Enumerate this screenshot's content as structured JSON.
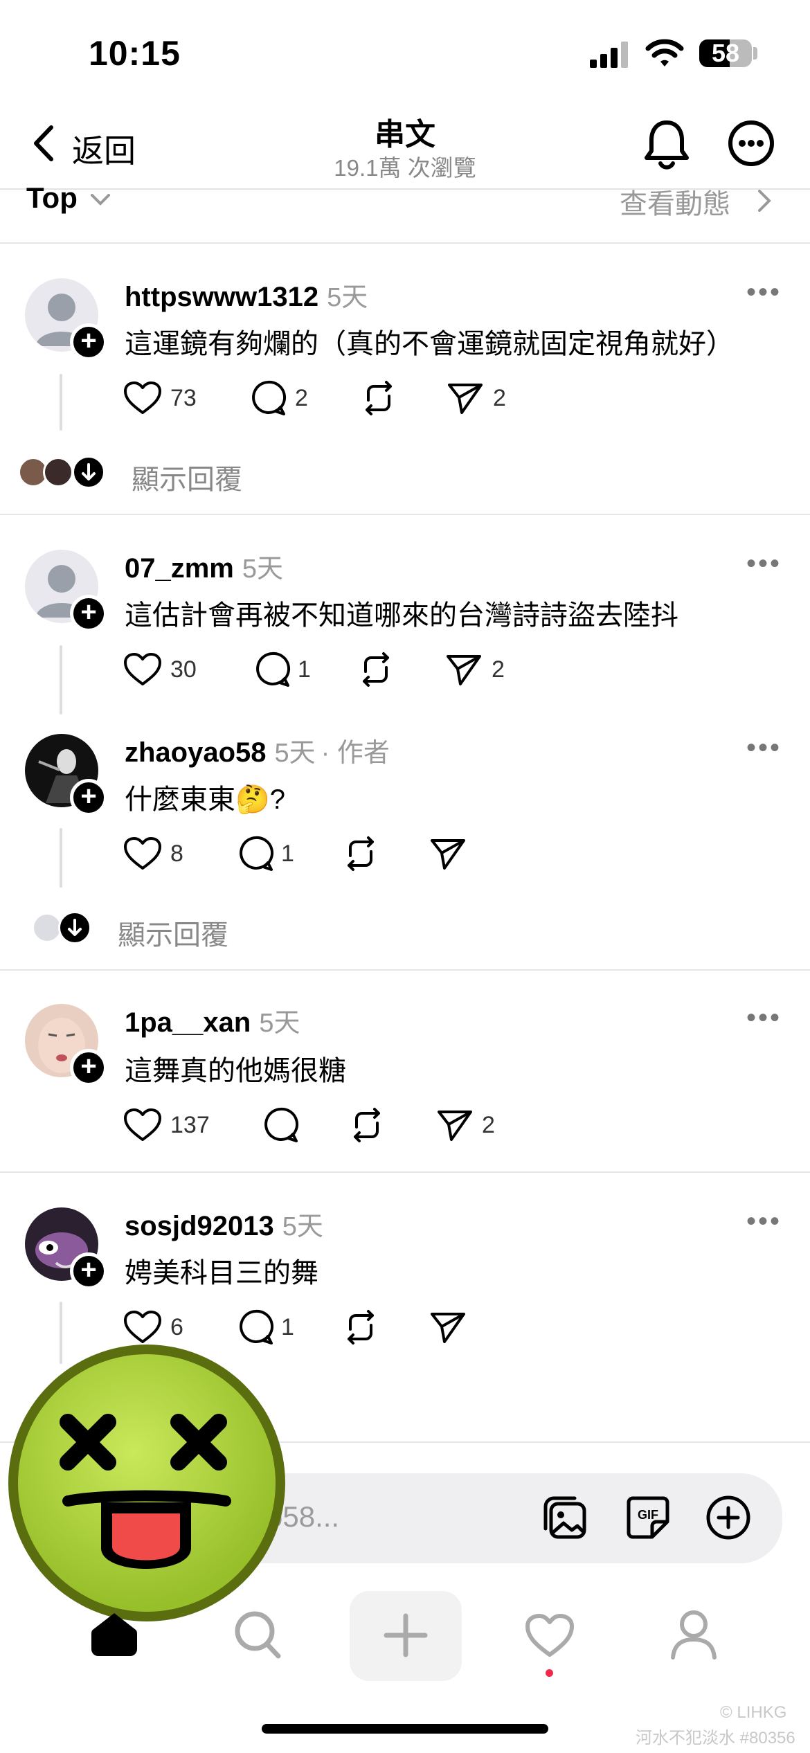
{
  "status_bar": {
    "time": "10:15",
    "battery": "58",
    "battery_level": 0.58
  },
  "header": {
    "back_label": "返回",
    "title": "串文",
    "subtitle": "19.1萬 次瀏覽"
  },
  "filter": {
    "sort_label": "Top",
    "activity_label": "查看動態"
  },
  "comments": [
    {
      "username": "httpswww1312",
      "time": "5天",
      "text": "這運鏡有夠爛的（真的不會運鏡就固定視角就好）",
      "likes": "73",
      "replies": "2",
      "shares": "2"
    },
    {
      "username": "07_zmm",
      "time": "5天",
      "text": "這估計會再被不知道哪來的台灣詩詩盜去陸抖",
      "likes": "30",
      "replies": "1",
      "shares": "2"
    },
    {
      "username": "zhaoyao58",
      "time": "5天",
      "author_tag": "· 作者",
      "text": "什麼東東🤔?",
      "likes": "8",
      "replies": "1"
    },
    {
      "username": "1pa__xan",
      "time": "5天",
      "text": "這舞真的他媽很糖",
      "likes": "137",
      "shares": "2"
    },
    {
      "username": "sosjd92013",
      "time": "5天",
      "text": "娉美科目三的舞",
      "likes": "6",
      "replies": "1"
    }
  ],
  "show_replies_label": "顯示回覆",
  "composer": {
    "placeholder_visible": "o58..."
  },
  "icons": {
    "back": "chevron-left-icon",
    "bell": "bell-icon",
    "more": "more-circle-icon",
    "like": "heart-icon",
    "comment": "comment-icon",
    "repost": "repost-icon",
    "share": "send-icon",
    "gallery": "image-icon",
    "gif": "gif-icon",
    "add": "plus-circle-icon",
    "home": "home-icon",
    "search": "search-icon",
    "new_post": "plus-icon",
    "activity": "heart-icon",
    "profile": "profile-icon"
  },
  "colors": {
    "notification_dot": "#f0284a",
    "sticker": "#a8cc3c"
  },
  "watermark": {
    "line1": "© LIHKG",
    "line2": "河水不犯淡水 #80356"
  }
}
